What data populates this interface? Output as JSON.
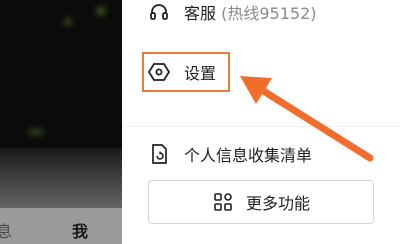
{
  "background_tabs": {
    "tab_left_partial": "息",
    "tab_me": "我"
  },
  "drawer": {
    "service": {
      "label": "客服",
      "hotline": "(热线95152)",
      "icon": "headset-icon"
    },
    "settings": {
      "label": "设置",
      "icon": "settings-hexagon-icon"
    },
    "privacy": {
      "label": "个人信息收集清单",
      "icon": "document-sync-icon"
    },
    "more": {
      "label": "更多功能",
      "icon": "grid-icon"
    }
  },
  "colors": {
    "highlight": "#f07a3a",
    "text": "#1f1f1f",
    "muted": "#8a8a8a"
  }
}
